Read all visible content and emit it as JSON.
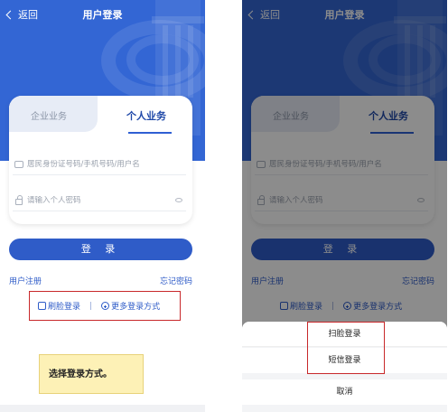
{
  "header": {
    "back_label": "返回",
    "title": "用户登录"
  },
  "tabs": {
    "enterprise": "企业业务",
    "personal": "个人业务"
  },
  "fields": {
    "account_placeholder": "居民身份证号码/手机号码/用户名",
    "password_placeholder": "请输入个人密码"
  },
  "login_button": "登 录",
  "links": {
    "register": "用户注册",
    "forgot": "忘记密码"
  },
  "alt_login": {
    "face": "刷脸登录",
    "separator": "|",
    "more": "更多登录方式"
  },
  "tooltip": "选择登录方式。",
  "sheet": {
    "option1": "扫脸登录",
    "option2": "短信登录",
    "cancel": "取消"
  },
  "colors": {
    "brand_blue": "#3366d4",
    "button_blue": "#2f5cc8",
    "highlight_red": "#c8282a",
    "tooltip_bg": "#fdf1b6"
  }
}
